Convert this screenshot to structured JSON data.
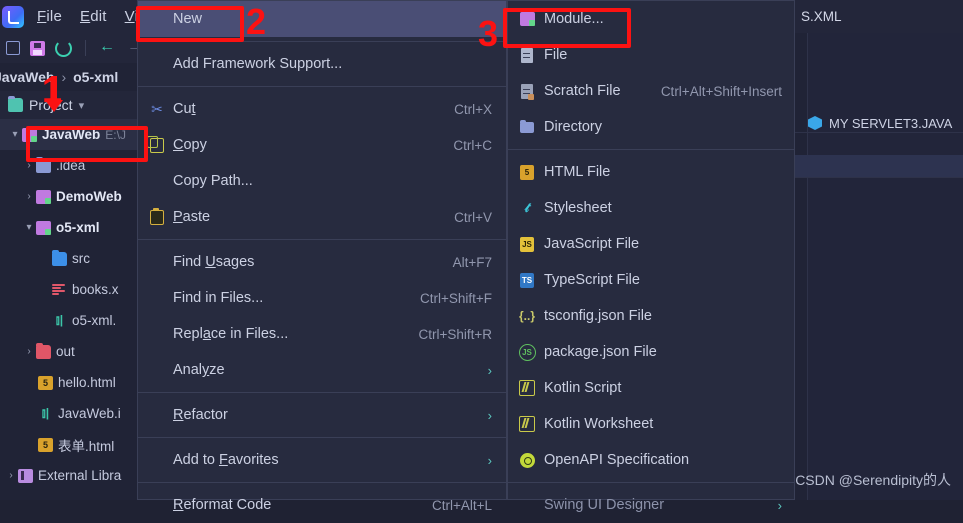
{
  "menubar": {
    "items": [
      {
        "label": "File",
        "accel": "F"
      },
      {
        "label": "Edit",
        "accel": "E"
      },
      {
        "label": "View",
        "accel": "V"
      }
    ]
  },
  "breadcrumb": {
    "project": "JavaWeb",
    "separator": "›",
    "module": "o5-xml"
  },
  "project_panel": {
    "title": "Project",
    "tree": [
      {
        "label": "JavaWeb",
        "detail": "E:\\J",
        "icon": "module-icon",
        "arrow": "⌄",
        "indent": 0,
        "bold": true,
        "selected": true
      },
      {
        "label": ".idea",
        "detail": "",
        "icon": "folder-icon",
        "arrow": "›",
        "indent": 1,
        "bold": false,
        "selected": false
      },
      {
        "label": "DemoWeb",
        "detail": "",
        "icon": "module-icon",
        "arrow": "›",
        "indent": 1,
        "bold": true,
        "selected": false
      },
      {
        "label": "o5-xml",
        "detail": "",
        "icon": "module-icon",
        "arrow": "⌄",
        "indent": 1,
        "bold": true,
        "selected": false
      },
      {
        "label": "src",
        "detail": "",
        "icon": "source-folder-icon",
        "arrow": "",
        "indent": 2,
        "bold": false,
        "selected": false
      },
      {
        "label": "books.x",
        "detail": "",
        "icon": "books-xml-icon",
        "arrow": "",
        "indent": 2,
        "bold": false,
        "selected": false
      },
      {
        "label": "o5-xml.",
        "detail": "",
        "icon": "xml-icon",
        "arrow": "",
        "indent": 2,
        "bold": false,
        "selected": false
      },
      {
        "label": "out",
        "detail": "",
        "icon": "output-folder-icon",
        "arrow": "›",
        "indent": 1,
        "bold": false,
        "selected": false
      },
      {
        "label": "hello.html",
        "detail": "",
        "icon": "html-file-icon",
        "arrow": "",
        "indent": 1,
        "bold": false,
        "selected": false
      },
      {
        "label": "JavaWeb.i",
        "detail": "",
        "icon": "xml-icon",
        "arrow": "",
        "indent": 1,
        "bold": false,
        "selected": false
      },
      {
        "label": "表单.html",
        "detail": "",
        "icon": "html-file-icon",
        "arrow": "",
        "indent": 1,
        "bold": false,
        "selected": false
      },
      {
        "label": "External Libra",
        "detail": "",
        "icon": "library-icon",
        "arrow": "›",
        "indent": 0,
        "bold": false,
        "selected": false
      }
    ]
  },
  "editor": {
    "tab_label": "S.XML",
    "structure_item": "MY SERVLET3.JAVA"
  },
  "context_menu": {
    "items": [
      {
        "label": "New",
        "accel": "",
        "key": "",
        "icon": "",
        "arrow": "",
        "highlighted": true,
        "separator_after": true
      },
      {
        "label": "Add Framework Support...",
        "accel": "",
        "key": "",
        "icon": "",
        "arrow": "",
        "highlighted": false,
        "separator_after": true
      },
      {
        "label": "Cut",
        "accel": "t",
        "key": "Ctrl+X",
        "icon": "scissors-icon",
        "arrow": "",
        "highlighted": false,
        "separator_after": false
      },
      {
        "label": "Copy",
        "accel": "C",
        "key": "Ctrl+C",
        "icon": "copy-icon",
        "arrow": "",
        "highlighted": false,
        "separator_after": false
      },
      {
        "label": "Copy Path...",
        "accel": "",
        "key": "",
        "icon": "",
        "arrow": "",
        "highlighted": false,
        "separator_after": false
      },
      {
        "label": "Paste",
        "accel": "P",
        "key": "Ctrl+V",
        "icon": "paste-icon",
        "arrow": "",
        "highlighted": false,
        "separator_after": true
      },
      {
        "label": "Find Usages",
        "accel": "U",
        "key": "Alt+F7",
        "icon": "",
        "arrow": "",
        "highlighted": false,
        "separator_after": false
      },
      {
        "label": "Find in Files...",
        "accel": "",
        "key": "Ctrl+Shift+F",
        "icon": "",
        "arrow": "",
        "highlighted": false,
        "separator_after": false
      },
      {
        "label": "Replace in Files...",
        "accel": "a",
        "key": "Ctrl+Shift+R",
        "icon": "",
        "arrow": "",
        "highlighted": false,
        "separator_after": false
      },
      {
        "label": "Analyze",
        "accel": "y",
        "key": "",
        "icon": "",
        "arrow": "›",
        "highlighted": false,
        "separator_after": true
      },
      {
        "label": "Refactor",
        "accel": "R",
        "key": "",
        "icon": "",
        "arrow": "›",
        "highlighted": false,
        "separator_after": true
      },
      {
        "label": "Add to Favorites",
        "accel": "F",
        "key": "",
        "icon": "",
        "arrow": "›",
        "highlighted": false,
        "separator_after": true
      },
      {
        "label": "Reformat Code",
        "accel": "R",
        "key": "Ctrl+Alt+L",
        "icon": "",
        "arrow": "",
        "highlighted": false,
        "separator_after": false
      }
    ]
  },
  "new_submenu": {
    "items": [
      {
        "label": "Module...",
        "key": "",
        "icon": "module-icon",
        "arrow": "",
        "separator_after": false
      },
      {
        "label": "File",
        "key": "",
        "icon": "file-icon",
        "arrow": "",
        "separator_after": false
      },
      {
        "label": "Scratch File",
        "key": "Ctrl+Alt+Shift+Insert",
        "icon": "scratch-file-icon",
        "arrow": "",
        "separator_after": false
      },
      {
        "label": "Directory",
        "key": "",
        "icon": "directory-icon",
        "arrow": "",
        "separator_after": true
      },
      {
        "label": "HTML File",
        "key": "",
        "icon": "html-file-icon",
        "arrow": "",
        "separator_after": false
      },
      {
        "label": "Stylesheet",
        "key": "",
        "icon": "css-file-icon",
        "arrow": "",
        "separator_after": false
      },
      {
        "label": "JavaScript File",
        "key": "",
        "icon": "javascript-file-icon",
        "arrow": "",
        "separator_after": false
      },
      {
        "label": "TypeScript File",
        "key": "",
        "icon": "typescript-file-icon",
        "arrow": "",
        "separator_after": false
      },
      {
        "label": "tsconfig.json File",
        "key": "",
        "icon": "tsconfig-icon",
        "arrow": "",
        "separator_after": false
      },
      {
        "label": "package.json File",
        "key": "",
        "icon": "package-json-icon",
        "arrow": "",
        "separator_after": false
      },
      {
        "label": "Kotlin Script",
        "key": "",
        "icon": "kotlin-icon",
        "arrow": "",
        "separator_after": false
      },
      {
        "label": "Kotlin Worksheet",
        "key": "",
        "icon": "kotlin-icon",
        "arrow": "",
        "separator_after": false
      },
      {
        "label": "OpenAPI Specification",
        "key": "",
        "icon": "openapi-icon",
        "arrow": "",
        "separator_after": true
      },
      {
        "label": "Swing UI Designer",
        "key": "",
        "icon": "",
        "arrow": "›",
        "separator_after": false
      }
    ]
  },
  "annotations": {
    "step1": "1",
    "step2": "2",
    "step3": "3"
  },
  "watermark": "CSDN @Serendipity的人",
  "colors": {
    "accent_red": "#fc1212",
    "menu_bg": "#272b3f",
    "highlight": "#4a4e75",
    "panel_bg": "#202336"
  }
}
